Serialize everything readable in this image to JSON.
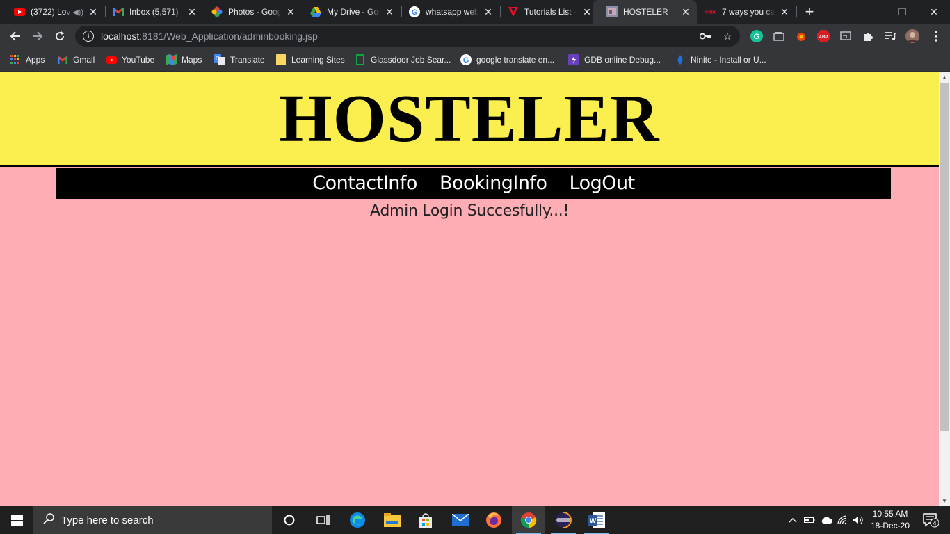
{
  "browser": {
    "tabs": [
      {
        "title": "(3722) Lov",
        "favicon": "youtube-icon",
        "active": false
      },
      {
        "title": "Inbox (5,571) -",
        "favicon": "gmail-icon",
        "active": false
      },
      {
        "title": "Photos - Goog",
        "favicon": "google-photos-icon",
        "active": false
      },
      {
        "title": "My Drive - Goo",
        "favicon": "google-drive-icon",
        "active": false
      },
      {
        "title": "whatsapp web",
        "favicon": "google-icon",
        "active": false
      },
      {
        "title": "Tutorials List -",
        "favicon": "tutorials-icon",
        "active": false
      },
      {
        "title": "HOSTELER",
        "favicon": "page-icon",
        "active": true
      },
      {
        "title": "7 ways you ca",
        "favicon": "cnbc-icon",
        "active": false
      }
    ],
    "address": {
      "host": "localhost",
      "path": ":8181/Web_Application/adminbooking.jsp"
    },
    "bookmarks": [
      {
        "label": "Apps",
        "icon": "apps-grid-icon"
      },
      {
        "label": "Gmail",
        "icon": "gmail-icon"
      },
      {
        "label": "YouTube",
        "icon": "youtube-icon"
      },
      {
        "label": "Maps",
        "icon": "maps-icon"
      },
      {
        "label": "Translate",
        "icon": "translate-icon"
      },
      {
        "label": "Learning Sites",
        "icon": "folder-icon"
      },
      {
        "label": "Glassdoor Job Sear...",
        "icon": "glassdoor-icon"
      },
      {
        "label": "google translate en...",
        "icon": "google-icon"
      },
      {
        "label": "GDB online Debug...",
        "icon": "gdb-icon"
      },
      {
        "label": "Ninite - Install or U...",
        "icon": "ninite-icon"
      }
    ]
  },
  "page": {
    "site_title": "HOSTELER",
    "nav": [
      "ContactInfo",
      "BookingInfo",
      "LogOut"
    ],
    "message": "Admin Login Succesfully...!"
  },
  "taskbar": {
    "search_placeholder": "Type here to search",
    "time": "10:55 AM",
    "date": "18-Dec-20",
    "notifications": "4"
  },
  "colors": {
    "header_bg": "#fbee4f",
    "page_bg": "#ffadb5",
    "nav_bg": "#000000"
  }
}
